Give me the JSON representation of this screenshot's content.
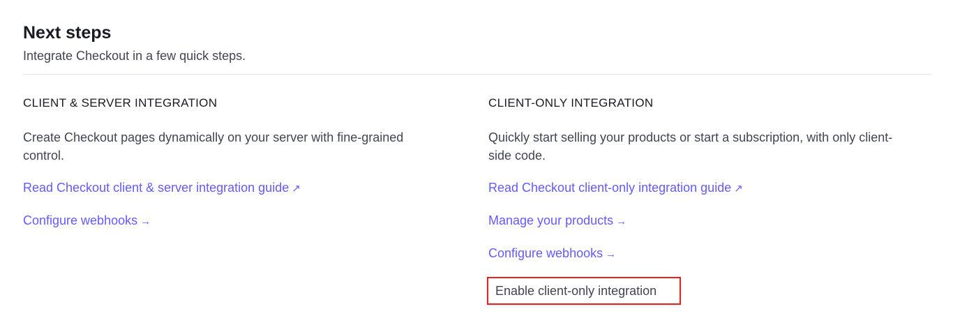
{
  "header": {
    "title": "Next steps",
    "subtitle": "Integrate Checkout in a few quick steps."
  },
  "left": {
    "heading": "CLIENT & SERVER INTEGRATION",
    "description": "Create Checkout pages dynamically on your server with fine-grained control.",
    "links": [
      {
        "label": "Read Checkout client & server integration guide",
        "icon": "↗"
      },
      {
        "label": "Configure webhooks",
        "icon": "→"
      }
    ]
  },
  "right": {
    "heading": "CLIENT-ONLY INTEGRATION",
    "description": "Quickly start selling your products or start a subscription, with only client-side code.",
    "links": [
      {
        "label": "Read Checkout client-only integration guide",
        "icon": "↗"
      },
      {
        "label": "Manage your products",
        "icon": "→"
      },
      {
        "label": "Configure webhooks",
        "icon": "→"
      }
    ],
    "button": "Enable client-only integration"
  },
  "colors": {
    "link": "#635bff",
    "highlight": "#e5231b"
  }
}
